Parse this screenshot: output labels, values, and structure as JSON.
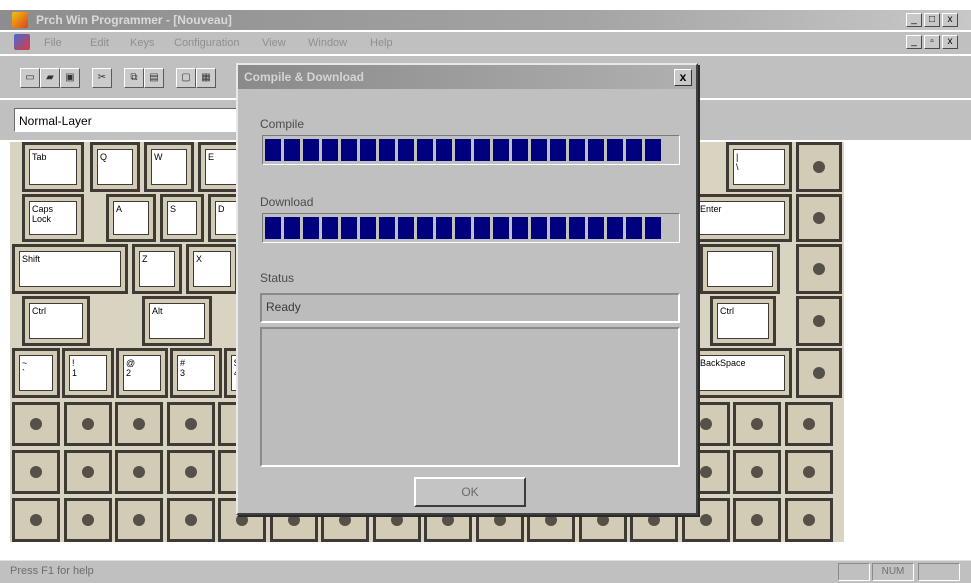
{
  "window": {
    "title": "Prch Win Programmer - [Nouveau]",
    "controls": [
      "_",
      "□",
      "x"
    ],
    "doc_controls": [
      "_",
      "▫",
      "x"
    ]
  },
  "menu": {
    "items": [
      "File",
      "Edit",
      "Keys",
      "Configuration",
      "View",
      "Window",
      "Help"
    ]
  },
  "toolbar": {
    "buttons": [
      "new-icon",
      "open-icon",
      "save-icon",
      "cut-icon",
      "copy-icon",
      "paste-icon",
      "print-preview-icon",
      "print-icon"
    ]
  },
  "layer": {
    "value": "Normal-Layer"
  },
  "keyboard": {
    "row1": [
      "Tab",
      "Q",
      "W",
      "E",
      "|\n\\"
    ],
    "row2": [
      "Caps\nLock",
      "A",
      "S",
      "D",
      "Enter"
    ],
    "row3": [
      "Shift",
      "Z",
      "X"
    ],
    "row4": [
      "Ctrl",
      "Alt",
      "Ctrl"
    ],
    "row5": [
      "~\n`",
      "!\n1",
      "@\n2",
      "#\n3",
      "$\n4",
      "BackSpace"
    ]
  },
  "dialog": {
    "title": "Compile & Download",
    "close": "x",
    "compile_label": "Compile",
    "download_label": "Download",
    "status_label": "Status",
    "status_value": "Ready",
    "ok_label": "OK",
    "compile_progress": 1.0,
    "download_progress": 1.0
  },
  "statusbar": {
    "help_text": "Press F1 for help",
    "num": "NUM"
  }
}
